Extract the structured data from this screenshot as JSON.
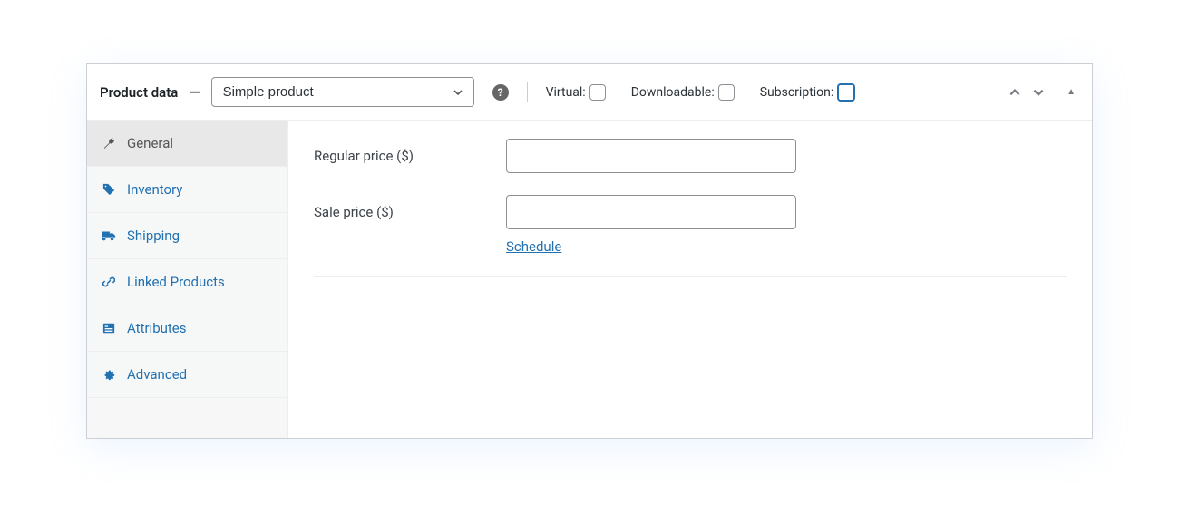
{
  "header": {
    "title": "Product data",
    "product_type": "Simple product",
    "checkboxes": {
      "virtual": {
        "label": "Virtual:",
        "checked": false
      },
      "downloadable": {
        "label": "Downloadable:",
        "checked": false
      },
      "subscription": {
        "label": "Subscription:",
        "checked": false
      }
    }
  },
  "tabs": [
    {
      "id": "general",
      "label": "General",
      "icon": "wrench",
      "active": true
    },
    {
      "id": "inventory",
      "label": "Inventory",
      "icon": "tag",
      "active": false
    },
    {
      "id": "shipping",
      "label": "Shipping",
      "icon": "truck",
      "active": false
    },
    {
      "id": "linked",
      "label": "Linked Products",
      "icon": "link",
      "active": false
    },
    {
      "id": "attributes",
      "label": "Attributes",
      "icon": "list",
      "active": false
    },
    {
      "id": "advanced",
      "label": "Advanced",
      "icon": "gear",
      "active": false
    }
  ],
  "general": {
    "regular_price": {
      "label": "Regular price ($)",
      "value": ""
    },
    "sale_price": {
      "label": "Sale price ($)",
      "value": "",
      "schedule_label": "Schedule"
    }
  }
}
